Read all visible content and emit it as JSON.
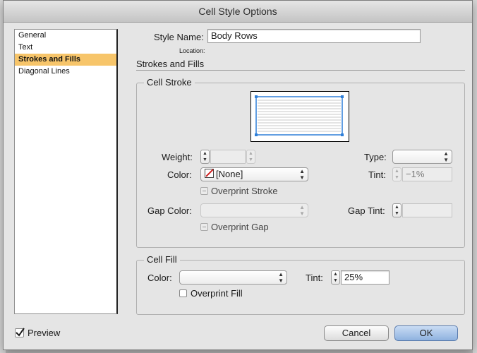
{
  "dialog": {
    "title": "Cell Style Options"
  },
  "sidebar": {
    "items": [
      {
        "label": "General",
        "selected": false
      },
      {
        "label": "Text",
        "selected": false
      },
      {
        "label": "Strokes and Fills",
        "selected": true
      },
      {
        "label": "Diagonal Lines",
        "selected": false
      }
    ]
  },
  "header": {
    "style_name_label": "Style Name:",
    "style_name_value": "Body Rows",
    "location_label": "Location:",
    "section_title": "Strokes and Fills"
  },
  "cell_stroke": {
    "title": "Cell Stroke",
    "weight_label": "Weight:",
    "weight_value": "",
    "type_label": "Type:",
    "type_value": "",
    "color_label": "Color:",
    "color_value": "[None]",
    "tint_label": "Tint:",
    "tint_value": "−1%",
    "overprint_stroke_label": "Overprint Stroke",
    "gap_color_label": "Gap Color:",
    "gap_color_value": "",
    "gap_tint_label": "Gap Tint:",
    "gap_tint_value": "",
    "overprint_gap_label": "Overprint Gap"
  },
  "cell_fill": {
    "title": "Cell Fill",
    "color_label": "Color:",
    "color_value": "",
    "tint_label": "Tint:",
    "tint_value": "25%",
    "overprint_fill_label": "Overprint Fill"
  },
  "footer": {
    "preview_label": "Preview",
    "preview_checked": true,
    "cancel_label": "Cancel",
    "ok_label": "OK"
  },
  "colors": {
    "selection": "#f7c56a",
    "handle": "#2f7fd8",
    "none_swatch": "#d02020"
  },
  "icons": {
    "popup": "up-down-chevron-icon",
    "stepper": "up-down-arrows-icon",
    "color_swatch": "none-swatch-icon"
  }
}
